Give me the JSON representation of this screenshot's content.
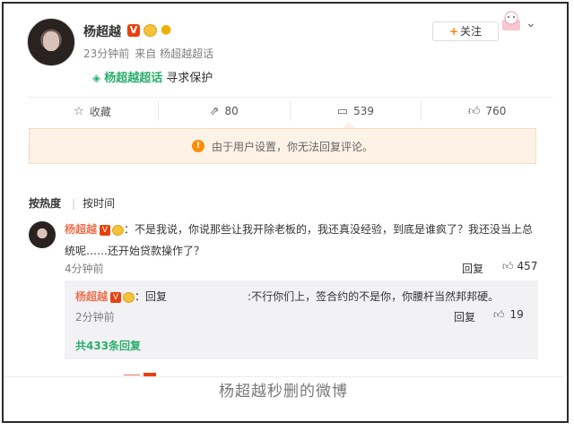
{
  "post": {
    "username": "杨超越",
    "time": "23分钟前",
    "source": "来自 杨超越超话",
    "topic_name": "杨超越超话",
    "topic_text": "寻求保护",
    "follow_label": "关注"
  },
  "actions": {
    "favorite": "收藏",
    "repost": "80",
    "comment": "539",
    "like": "760"
  },
  "notice": "由于用户设置，你无法回复评论。",
  "sort": {
    "hot": "按热度",
    "time": "按时间"
  },
  "comment": {
    "name": "杨超越",
    "text": "：不是我说，你说那些让我开除老板的，我还真没经验，到底是谁疯了？我还没当上总统呢……还开始贷款操作了？",
    "time": "4分钟前",
    "reply_label": "回复",
    "likes": "457"
  },
  "reply": {
    "name": "杨超越",
    "prefix": "：回复",
    "text": ":不行你们上，签合约的不是你，你腰杆当然邦邦硬。",
    "time": "2分钟前",
    "reply_label": "回复",
    "likes": "19",
    "more": "共433条回复"
  },
  "caption": "杨超越秒删的微博",
  "colors": {
    "orange": "#ff8200",
    "green": "#2cae6b",
    "name": "#eb7350",
    "notice_bg": "#fdf2e6"
  }
}
